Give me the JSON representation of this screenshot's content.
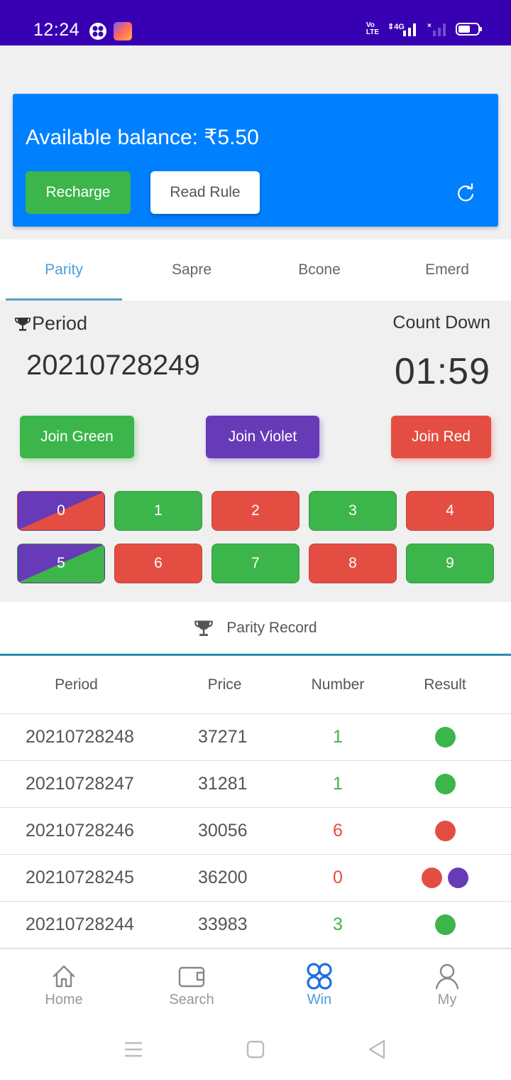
{
  "status_bar": {
    "time": "12:24",
    "network": "4G",
    "volte": "Vo LTE"
  },
  "balance_card": {
    "balance_text": "Available balance: ₹5.50",
    "recharge_label": "Recharge",
    "read_rule_label": "Read Rule",
    "refresh_icon": "refresh-icon"
  },
  "tabs": [
    {
      "label": "Parity",
      "active": true
    },
    {
      "label": "Sapre",
      "active": false
    },
    {
      "label": "Bcone",
      "active": false
    },
    {
      "label": "Emerd",
      "active": false
    }
  ],
  "game": {
    "period_label": "Period",
    "period_value": "20210728249",
    "countdown_label": "Count Down",
    "countdown_value": "01:59",
    "join_green": "Join Green",
    "join_violet": "Join Violet",
    "join_red": "Join Red",
    "numbers": [
      {
        "label": "0",
        "color": "violet-red"
      },
      {
        "label": "1",
        "color": "green"
      },
      {
        "label": "2",
        "color": "red"
      },
      {
        "label": "3",
        "color": "green"
      },
      {
        "label": "4",
        "color": "red"
      },
      {
        "label": "5",
        "color": "violet-green"
      },
      {
        "label": "6",
        "color": "red"
      },
      {
        "label": "7",
        "color": "green"
      },
      {
        "label": "8",
        "color": "red"
      },
      {
        "label": "9",
        "color": "green"
      }
    ]
  },
  "record": {
    "title": "Parity Record",
    "columns": [
      "Period",
      "Price",
      "Number",
      "Result"
    ],
    "rows": [
      {
        "period": "20210728248",
        "price": "37271",
        "number": "1",
        "number_color": "#3cb54a",
        "result": [
          "#3cb54a"
        ]
      },
      {
        "period": "20210728247",
        "price": "31281",
        "number": "1",
        "number_color": "#3cb54a",
        "result": [
          "#3cb54a"
        ]
      },
      {
        "period": "20210728246",
        "price": "30056",
        "number": "6",
        "number_color": "#e44e42",
        "result": [
          "#e44e42"
        ]
      },
      {
        "period": "20210728245",
        "price": "36200",
        "number": "0",
        "number_color": "#e44e42",
        "result": [
          "#e44e42",
          "#673ab7"
        ]
      },
      {
        "period": "20210728244",
        "price": "33983",
        "number": "3",
        "number_color": "#3cb54a",
        "result": [
          "#3cb54a"
        ]
      }
    ]
  },
  "bottom_nav": [
    {
      "label": "Home",
      "icon": "home-icon",
      "active": false
    },
    {
      "label": "Search",
      "icon": "wallet-icon",
      "active": false
    },
    {
      "label": "Win",
      "icon": "clover-icon",
      "active": true
    },
    {
      "label": "My",
      "icon": "user-icon",
      "active": false
    }
  ],
  "colors": {
    "status_bar": "#3700b3",
    "card_blue": "#0080ff",
    "green": "#3cb54a",
    "red": "#e44e42",
    "violet": "#673ab7",
    "active_tab": "#4a9ede"
  }
}
